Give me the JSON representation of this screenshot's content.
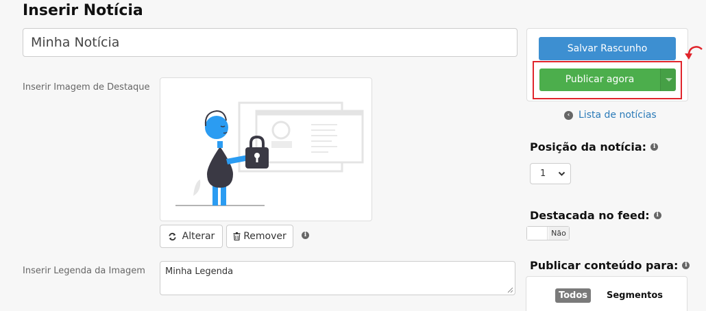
{
  "page": {
    "title": "Inserir Notícia"
  },
  "form": {
    "title_value": "Minha Notícia",
    "image_label": "Inserir Imagem de Destaque",
    "change_label": "Alterar",
    "remove_label": "Remover",
    "caption_label": "Inserir Legenda da Imagem",
    "caption_value": "Minha Legenda"
  },
  "sidebar": {
    "draft_label": "Salvar Rascunho",
    "publish_label": "Publicar agora",
    "list_link": "Lista de notícias",
    "position_heading": "Posição da notícia:",
    "position_value": "1",
    "featured_heading": "Destacada no feed:",
    "featured_value": "Não",
    "audience_heading": "Publicar conteúdo para:",
    "audience_options": [
      "Todos",
      "Segmentos"
    ],
    "audience_selected": "Todos"
  },
  "colors": {
    "draft_button": "#3d8fd1",
    "publish_button": "#4cae4c",
    "highlight": "#e0242b",
    "link": "#2a7ab8"
  },
  "icons": [
    "refresh-icon",
    "trash-icon",
    "info-icon",
    "chevron-left-circle-icon",
    "chevron-down-icon",
    "curved-arrow-icon",
    "caret-down-icon"
  ]
}
